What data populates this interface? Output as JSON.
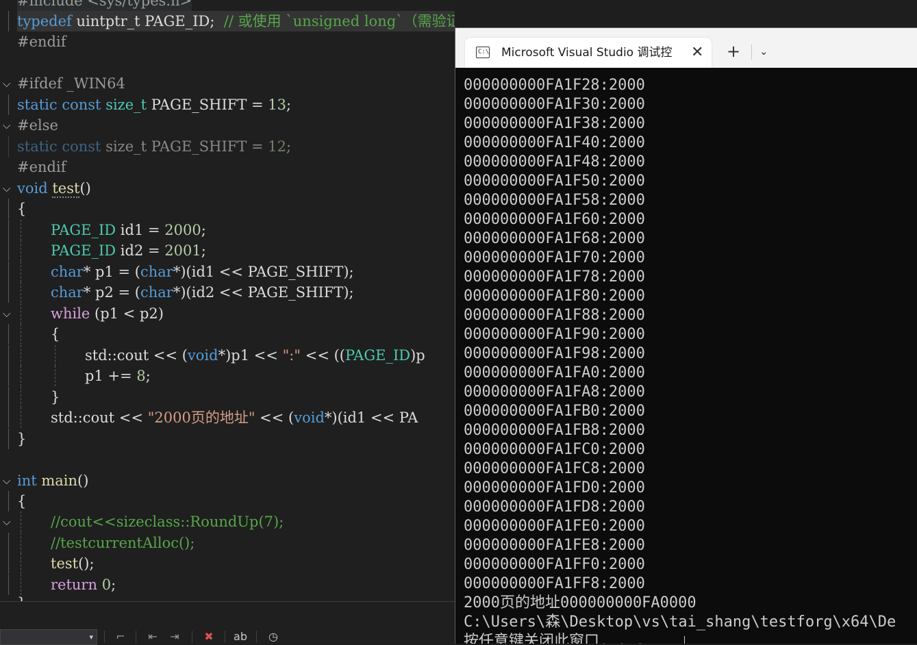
{
  "editor": {
    "lines": [
      {
        "t": "pp",
        "text": "#include <sys/types.h>"
      },
      {
        "t": "raw"
      },
      {
        "t": "pp",
        "text": "#endif"
      },
      {
        "t": "blank"
      },
      {
        "t": "pp",
        "text": "#ifdef _WIN64"
      },
      {
        "t": "raw"
      },
      {
        "t": "pp",
        "text": "#else"
      },
      {
        "t": "raw"
      },
      {
        "t": "pp",
        "text": "#endif"
      }
    ],
    "typedef_kw": "typedef",
    "typedef_rest": " uintptr_t PAGE_ID;  ",
    "typedef_comment": "// 或使用 `unsigned long`（需验证平台匹配性）",
    "static_kw": "static",
    "const_kw": "const",
    "size_t": "size_t",
    "page_shift_13": " PAGE_SHIFT = ",
    "num_13": "13",
    "num_12": "12",
    "void_kw": "void",
    "test_fn": "test",
    "parens": "()",
    "brace_open": "{",
    "brace_close": "}",
    "page_id_type": "PAGE_ID",
    "id1_decl": " id1 = ",
    "id2_decl": " id2 = ",
    "num_2000": "2000",
    "num_2001": "2001",
    "semi": ";",
    "char_kw": "char",
    "p1_decl": "* p1 = (",
    "p2_decl": "* p2 = (",
    "cast_tail_1": "*)(id1 << PAGE_SHIFT);",
    "cast_tail_2": "*)(id2 << PAGE_SHIFT);",
    "while_kw": "while",
    "while_cond": " (p1 < p2)",
    "cout_1a": "std::cout << (",
    "void_ptr": "void",
    "cout_1b": "*)p1 << ",
    "colon_str": "\":\"",
    "cout_1c": " << ((",
    "cout_1d": ")p",
    "p1_inc": "p1 += ",
    "num_8": "8",
    "cout_2a": "std::cout << ",
    "str_2000": "\"2000页的地址\"",
    "cout_2b": " << (",
    "cout_2c": "*)(id1 << PA",
    "int_kw": "int",
    "main_fn": " main",
    "cmt_roundup": "//cout<<sizeclass::RoundUp(7);",
    "cmt_testalloc": "//testcurrentAlloc();",
    "test_call": "test",
    "call_tail": "();",
    "return_kw": "return",
    "ret_zero_sp": " ",
    "num_0": "0",
    "partial": "}"
  },
  "console": {
    "tab_title": "Microsoft Visual Studio 调试控制台",
    "icon_label": "C:\\",
    "close_glyph": "✕",
    "new_tab_glyph": "+",
    "dropdown_glyph": "⌄",
    "output": [
      "000000000FA1F28:2000",
      "000000000FA1F30:2000",
      "000000000FA1F38:2000",
      "000000000FA1F40:2000",
      "000000000FA1F48:2000",
      "000000000FA1F50:2000",
      "000000000FA1F58:2000",
      "000000000FA1F60:2000",
      "000000000FA1F68:2000",
      "000000000FA1F70:2000",
      "000000000FA1F78:2000",
      "000000000FA1F80:2000",
      "000000000FA1F88:2000",
      "000000000FA1F90:2000",
      "000000000FA1F98:2000",
      "000000000FA1FA0:2000",
      "000000000FA1FA8:2000",
      "000000000FA1FB0:2000",
      "000000000FA1FB8:2000",
      "000000000FA1FC0:2000",
      "000000000FA1FC8:2000",
      "000000000FA1FD0:2000",
      "000000000FA1FD8:2000",
      "000000000FA1FE0:2000",
      "000000000FA1FE8:2000",
      "000000000FA1FF0:2000",
      "000000000FA1FF8:2000",
      "2000页的地址000000000FA0000",
      "C:\\Users\\森\\Desktop\\vs\\tai_shang\\testforg\\x64\\De",
      "按任意键关闭此窗口. . ."
    ]
  },
  "toolbar": {
    "combo_arrow": "▾",
    "icons": [
      "format-icon",
      "indent-left-icon",
      "indent-right-icon",
      "clear-bookmarks-icon",
      "rename-icon",
      "history-icon"
    ]
  }
}
